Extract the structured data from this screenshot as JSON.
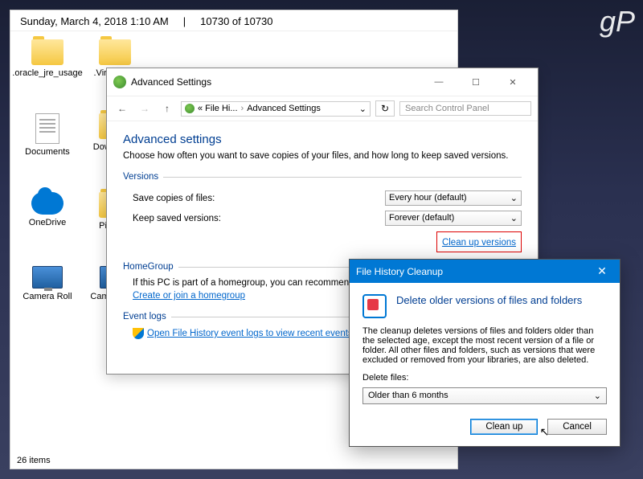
{
  "watermark": "gP",
  "explorer": {
    "date_text": "Sunday, March 4, 2018 1:10 AM",
    "count_text": "10730 of 10730",
    "status": "26 items",
    "items": [
      {
        "label": ".oracle_jre_usage",
        "icon": "folder"
      },
      {
        "label": ".VirtualBox",
        "icon": "folder"
      },
      {
        "label": "Documents",
        "icon": "doc"
      },
      {
        "label": "Downloads",
        "icon": "folder"
      },
      {
        "label": "OneDrive",
        "icon": "onedrive"
      },
      {
        "label": "Pictures",
        "icon": "folder"
      },
      {
        "label": "Camera Roll",
        "icon": "monitor"
      },
      {
        "label": "Camera Roll",
        "icon": "monitor"
      }
    ]
  },
  "adv": {
    "window_title": "Advanced Settings",
    "breadcrumb": {
      "a": "« File Hi...",
      "b": "Advanced Settings"
    },
    "search_placeholder": "Search Control Panel",
    "h2": "Advanced settings",
    "desc": "Choose how often you want to save copies of your files, and how long to keep saved versions.",
    "versions": {
      "title": "Versions",
      "row1": {
        "label": "Save copies of files:",
        "value": "Every hour (default)"
      },
      "row2": {
        "label": "Keep saved versions:",
        "value": "Forever (default)"
      },
      "cleanup_link": "Clean up versions"
    },
    "homegroup": {
      "title": "HomeGroup",
      "text": "If this PC is part of a homegroup, you can recommend this drive to other homegroup members.",
      "link": "Create or join a homegroup"
    },
    "eventlogs": {
      "title": "Event logs",
      "link": "Open File History event logs to view recent events or errors"
    }
  },
  "fhc": {
    "title": "File History Cleanup",
    "heading": "Delete older versions of files and folders",
    "text": "The cleanup deletes versions of files and folders older than the selected age, except the most recent version of a file or folder. All other files and folders, such as versions that were excluded or removed from your libraries, are also deleted.",
    "label": "Delete files:",
    "select": "Older than 6 months",
    "cleanup_btn": "Clean up",
    "cancel_btn": "Cancel"
  }
}
